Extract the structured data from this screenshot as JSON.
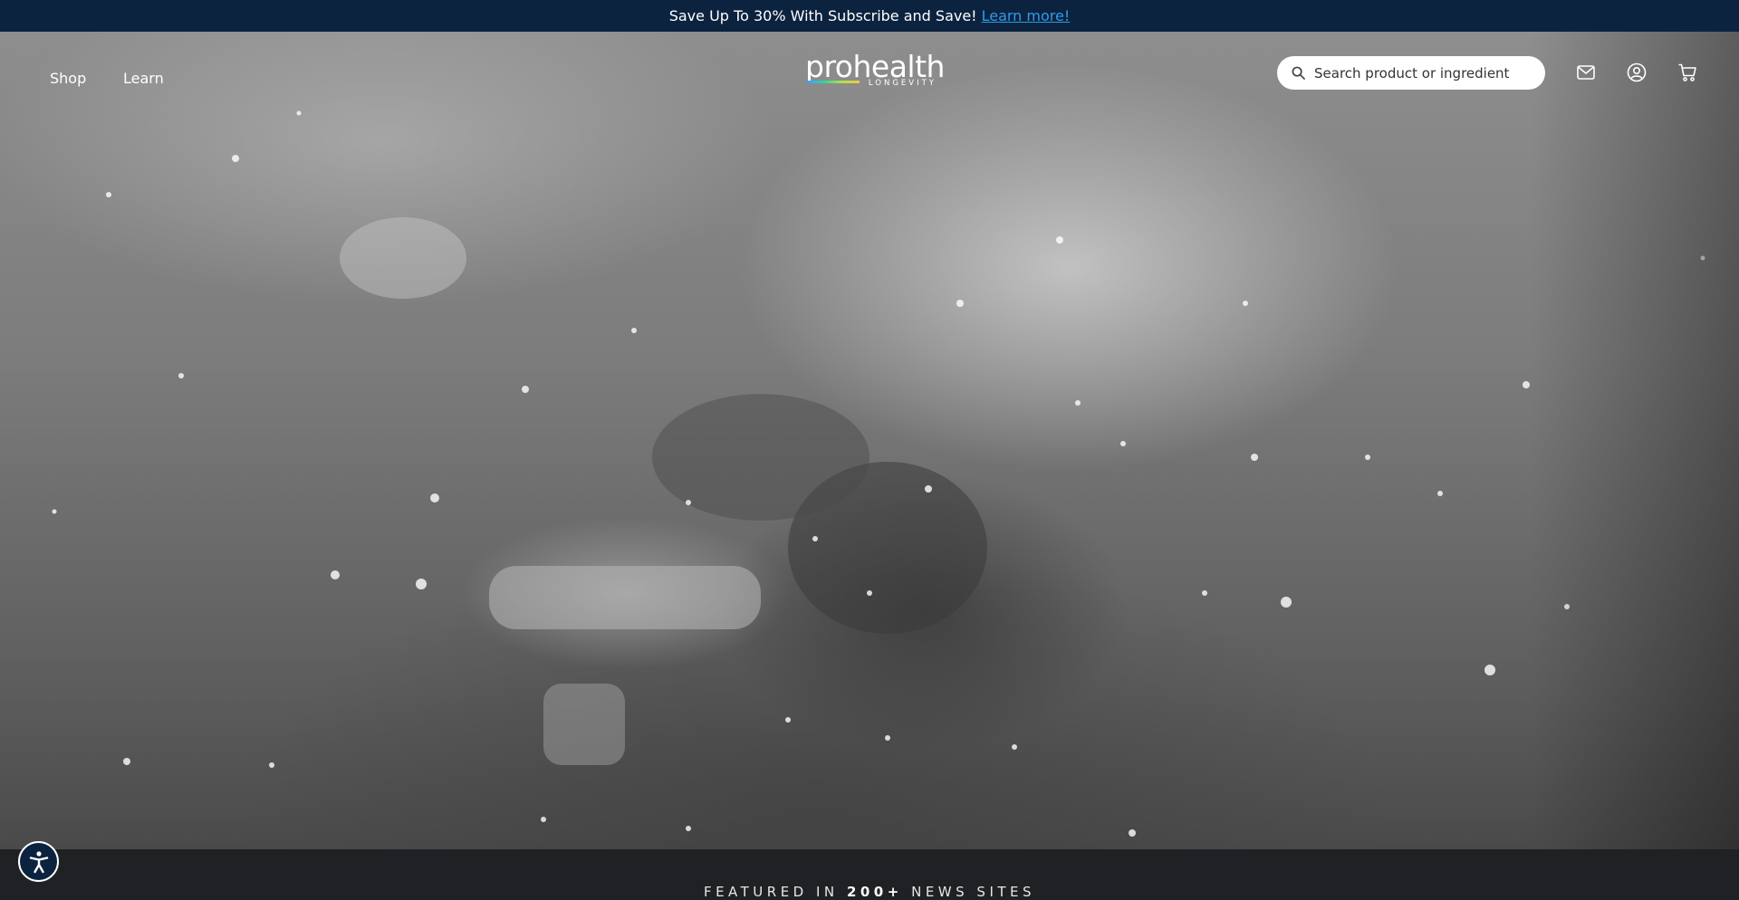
{
  "announcement": {
    "text": "Save Up To 30% With Subscribe and Save!",
    "link": "Learn more!"
  },
  "nav": {
    "shop": "Shop",
    "learn": "Learn"
  },
  "logo": {
    "main": "prohealth",
    "sub": "LONGEVITY"
  },
  "search": {
    "placeholder": "Search product or ingredient",
    "icon": "search-icon"
  },
  "header_icons": [
    "mail-icon",
    "account-icon",
    "cart-icon"
  ],
  "featured": {
    "prefix": "FEATURED IN",
    "count": "200+",
    "suffix": "NEWS SITES"
  },
  "accessibility": {
    "icon": "accessibility-icon"
  },
  "colors": {
    "announcement_bg": "#0c2340",
    "link": "#2f9be8",
    "footer_bg": "#1f2124"
  }
}
